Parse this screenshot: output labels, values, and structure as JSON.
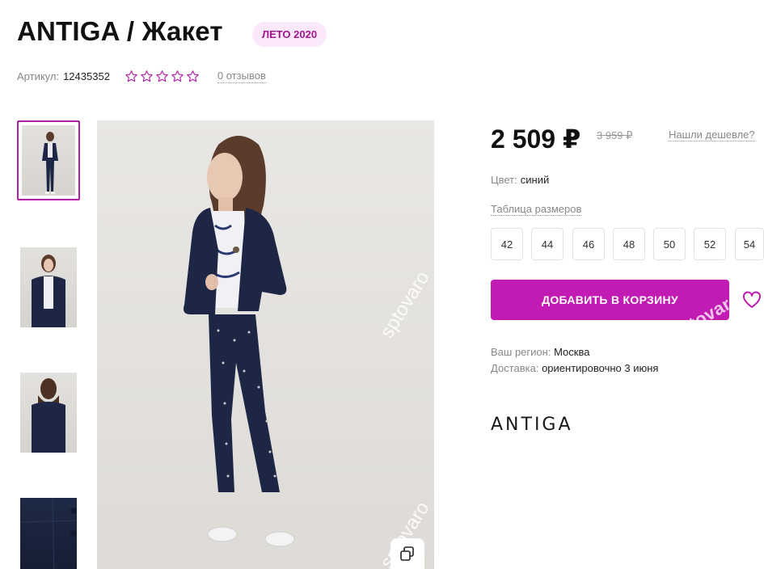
{
  "product": {
    "title": "ANTIGA / Жакет",
    "season_badge": "ЛЕТО 2020",
    "sku_label": "Артикул:",
    "sku_value": "12435352",
    "rating": 0,
    "reviews_text": "0 отзывов"
  },
  "gallery": {
    "thumbnails_count": 4,
    "active_thumbnail": 0,
    "watermark": "sptovaro"
  },
  "pricing": {
    "price": "2 509 ₽",
    "old_price": "3 959 ₽",
    "cheaper_link": "Нашли дешевле?"
  },
  "color": {
    "label": "Цвет:",
    "value": "синий"
  },
  "sizes": {
    "table_link": "Таблица размеров",
    "options": [
      "42",
      "44",
      "46",
      "48",
      "50",
      "52",
      "54"
    ]
  },
  "cart": {
    "add_label": "ДОБАВИТЬ В КОРЗИНУ"
  },
  "delivery": {
    "region_label": "Ваш регион:",
    "region_value": "Москва",
    "delivery_label": "Доставка:",
    "delivery_value": "ориентировочно 3 июня"
  },
  "brand": {
    "logo_text": "ANTIGA"
  },
  "colors": {
    "accent": "#c21bb4",
    "badge_bg": "#fbe8fa",
    "badge_text": "#a0178f",
    "jacket": "#1d2745"
  },
  "icons": {
    "rating": "star-outline-icon",
    "favorite": "heart-outline-icon",
    "zoom": "copy-icon"
  }
}
